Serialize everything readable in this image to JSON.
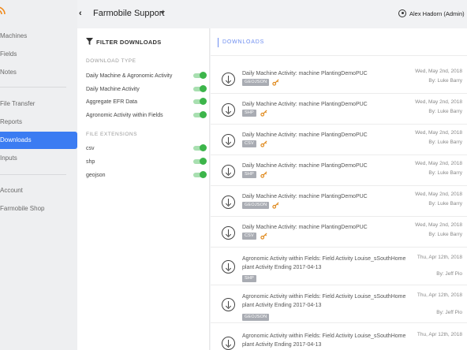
{
  "nav": {
    "items": [
      {
        "label": "Machines",
        "active": false
      },
      {
        "label": "Fields",
        "active": false
      },
      {
        "label": "Notes",
        "active": false
      },
      {
        "label": "File Transfer",
        "active": false
      },
      {
        "label": "Reports",
        "active": false
      },
      {
        "label": "Downloads",
        "active": true
      },
      {
        "label": "Inputs",
        "active": false
      },
      {
        "label": "Account",
        "active": false
      },
      {
        "label": "Farmobile Shop",
        "active": false
      }
    ],
    "logo_icon": "wifi-signal-icon",
    "accent_color": "#3b7cf2"
  },
  "header": {
    "back_icon": "chevron-left-icon",
    "org_name": "Farmobile Support",
    "user_icon": "user-circle-icon",
    "user_name": "Alex Hadorn (Admin)"
  },
  "filter": {
    "title": "FILTER DOWNLOADS",
    "download_type_label": "DOWNLOAD TYPE",
    "download_types": [
      {
        "label": "Daily Machine & Agronomic Activity",
        "enabled": true
      },
      {
        "label": "Daily Machine Activity",
        "enabled": true
      },
      {
        "label": "Aggregate EFR Data",
        "enabled": true
      },
      {
        "label": "Agronomic Activity within Fields",
        "enabled": true
      }
    ],
    "extensions_label": "FILE EXTENSIONS",
    "extensions": [
      {
        "label": "csv",
        "enabled": true
      },
      {
        "label": "shp",
        "enabled": true
      },
      {
        "label": "geojson",
        "enabled": true
      }
    ],
    "toggle_color": "#3cb54a"
  },
  "downloads": {
    "title": "DOWNLOADS",
    "rows": [
      {
        "title": "Daily Machine Activity: machine PlantingDemoPUC",
        "badge": "GEOJSON",
        "date": "Wed, May 2nd, 2018",
        "by": "By: Luke Barry",
        "has_key": true
      },
      {
        "title": "Daily Machine Activity: machine PlantingDemoPUC",
        "badge": "SHP",
        "date": "Wed, May 2nd, 2018",
        "by": "By: Luke Barry",
        "has_key": true
      },
      {
        "title": "Daily Machine Activity: machine PlantingDemoPUC",
        "badge": "CSV",
        "date": "Wed, May 2nd, 2018",
        "by": "By: Luke Barry",
        "has_key": true
      },
      {
        "title": "Daily Machine Activity: machine PlantingDemoPUC",
        "badge": "SHP",
        "date": "Wed, May 2nd, 2018",
        "by": "By: Luke Barry",
        "has_key": true
      },
      {
        "title": "Daily Machine Activity: machine PlantingDemoPUC",
        "badge": "GEOJSON",
        "date": "Wed, May 2nd, 2018",
        "by": "By: Luke Barry",
        "has_key": true
      },
      {
        "title": "Daily Machine Activity: machine PlantingDemoPUC",
        "badge": "CSV",
        "date": "Wed, May 2nd, 2018",
        "by": "By: Luke Barry",
        "has_key": true
      },
      {
        "title": "Agronomic Activity within Fields: Field Activity Louise_sSouthHome plant Activity Ending 2017-04-13",
        "badge": "SHP",
        "date": "Thu, Apr 12th, 2018",
        "by": "By: Jeff Pio",
        "has_key": false
      },
      {
        "title": "Agronomic Activity within Fields: Field Activity Louise_sSouthHome plant Activity Ending 2017-04-13",
        "badge": "GEOJSON",
        "date": "Thu, Apr 12th, 2018",
        "by": "By: Jeff Pio",
        "has_key": false
      },
      {
        "title": "Agronomic Activity within Fields: Field Activity Louise_sSouthHome plant Activity Ending 2017-04-13",
        "badge": "",
        "date": "Thu, Apr 12th, 2018",
        "by": "",
        "has_key": false
      }
    ],
    "download_icon": "download-circle-icon",
    "key_icon": "key-icon",
    "key_color": "#e08a1e",
    "header_accent": "#6e8ef0"
  }
}
